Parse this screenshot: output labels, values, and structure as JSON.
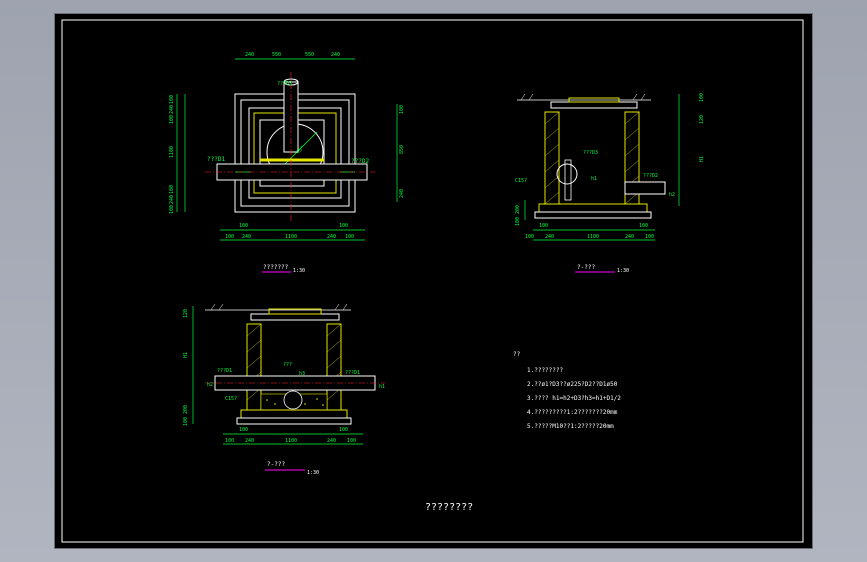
{
  "views": {
    "plan": {
      "caption": "???????",
      "scale": "1:30"
    },
    "section_a": {
      "caption": "?-???",
      "scale": "1:30"
    },
    "section_b": {
      "caption": "?-???",
      "scale": "1:30"
    }
  },
  "dimensions": {
    "plan_top": [
      "240",
      "550",
      "550",
      "240"
    ],
    "plan_bottom_1": [
      "100",
      "100"
    ],
    "plan_bottom_2": [
      "100",
      "240",
      "1100",
      "240",
      "100"
    ],
    "plan_left": [
      "100",
      "240",
      "100",
      "1100",
      "100",
      "240",
      "100"
    ],
    "plan_right": [
      "100",
      "850",
      "240"
    ],
    "sec_a_bottom_1": [
      "100",
      "100"
    ],
    "sec_a_bottom_2": [
      "100",
      "240",
      "1100",
      "240",
      "100"
    ],
    "sec_a_right": [
      "100",
      "120",
      "H1"
    ],
    "sec_a_left": [
      "100",
      "200"
    ],
    "sec_b_bottom_1": [
      "100",
      "100"
    ],
    "sec_b_bottom_2": [
      "100",
      "240",
      "1100",
      "240",
      "100"
    ],
    "sec_b_left": [
      "120",
      "H1",
      "100",
      "200"
    ]
  },
  "labels": {
    "plan_inlet": "???D1",
    "plan_outlet": "???D2",
    "plan_pipe_top": "???D3",
    "plan_angle": "45°",
    "sec_a_pipe": "???D3",
    "sec_a_outlet": "???D2",
    "sec_a_h1": "h1",
    "sec_a_h2": "h2",
    "sec_a_conc": "C15?",
    "sec_b_inlet": "???D1",
    "sec_b_outlet": "???D1",
    "sec_b_h3": "h3",
    "sec_b_h2": "h2",
    "sec_b_h1": "h1",
    "sec_b_conc": "C15?",
    "sec_b_pipe": "???"
  },
  "notes": {
    "heading": "??",
    "items": [
      "1.????????",
      "2.??ø1?D3??ø225?D2??D1ø50",
      "3.????  h1=h2+D3?h3=h1+D1/2",
      "4.?????????1:2???????20mm",
      "5.?????M10??1:2?????20mm"
    ]
  },
  "sheet_title": "????????",
  "colors": {
    "background": "#000000",
    "green": "#00ff3c",
    "white": "#ffffff",
    "yellow": "#e6e600",
    "magenta": "#ff00ff",
    "red": "#ff2020",
    "gray": "#b0b0b0"
  }
}
